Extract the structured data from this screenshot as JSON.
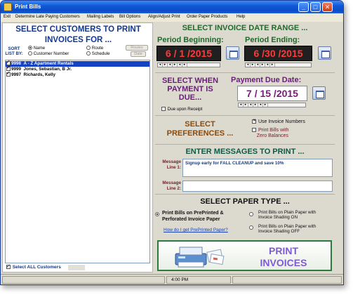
{
  "window": {
    "title": "Print Bills"
  },
  "menu": [
    "Exit",
    "Determine Late Paying Customers",
    "Mailing Labels",
    "Bill Options",
    "Align/Adjust Print",
    "Order Paper Products",
    "Help"
  ],
  "customers": {
    "title_line1": "SELECT CUSTOMERS TO PRINT",
    "title_line2": "INVOICES FOR ...",
    "sort_label": "SORT LIST BY:",
    "sort_options": [
      "Name",
      "Customer Number",
      "Route",
      "Schedule"
    ],
    "sort_selected": "Name",
    "route_button": "Routes",
    "date_button": "Date",
    "list": [
      {
        "number": "9998",
        "name": "A - Z Apartment Rentals",
        "checked": true,
        "selected": true
      },
      {
        "number": "9999",
        "name": "Jones, Sebastian, B Jr.",
        "checked": true,
        "selected": false
      },
      {
        "number": "9997",
        "name": "Richards, Kelly",
        "checked": true,
        "selected": false
      }
    ],
    "select_all_label": "Select ALL Customers"
  },
  "date_range": {
    "heading": "SELECT INVOICE DATE RANGE ...",
    "begin_label": "Period Beginning:",
    "end_label": "Period Ending:",
    "begin_date": "6 / 1 /2015",
    "end_date": "6 /30 /2015"
  },
  "payment": {
    "heading_line1": "SELECT WHEN",
    "heading_line2": "PAYMENT IS",
    "heading_line3": "DUE...",
    "due_receipt_label": "Due upon Receipt",
    "due_date_label": "Payment Due Date:",
    "due_date": "7 / 15 /2015"
  },
  "preferences": {
    "heading_line1": "SELECT",
    "heading_line2": "PREFERENCES ...",
    "use_invoice_numbers": "Use Invoice Numbers",
    "print_zero_line1": "Print Bills with",
    "print_zero_line2": "Zero Balances"
  },
  "messages": {
    "heading": "ENTER MESSAGES TO PRINT ...",
    "line1_label_a": "Message",
    "line1_label_b": "Line 1:",
    "line1_value": "Signup early for FALL CLEANUP and save 10%",
    "line2_label_a": "Message",
    "line2_label_b": "Line 2:",
    "line2_value": ""
  },
  "paper": {
    "heading": "SELECT PAPER TYPE ...",
    "opt_preprinted_line1": "Print Bills on PrePrinted &",
    "opt_preprinted_line2": "Perforated Invoice Paper",
    "opt_shading_on_line1": "Print Bills on Plain Paper with",
    "opt_shading_on_line2": "Invoice Shading ON",
    "opt_shading_off_line1": "Print Bills on Plain Paper with",
    "opt_shading_off_line2": "Invoice Shading OFF",
    "help_link": "How do I get PrePrinted Paper?"
  },
  "print_button": {
    "line1": "PRINT",
    "line2": "INVOICES"
  },
  "status": {
    "time": "4:00 PM"
  },
  "colors": {
    "title_blue": "#12388f",
    "green": "#1f6a28",
    "purple": "#6b1c7a",
    "brown": "#8a4a0d",
    "date_red": "#ff3a3a",
    "list_select": "#1542c4"
  }
}
